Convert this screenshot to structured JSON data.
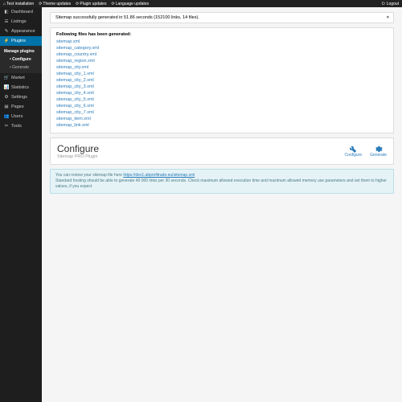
{
  "topbar": {
    "left": [
      {
        "icon": "home",
        "label": "Test installation"
      },
      {
        "icon": "refresh",
        "label": "Theme updates"
      },
      {
        "icon": "refresh",
        "label": "Plugin updates"
      },
      {
        "icon": "refresh",
        "label": "Language updates"
      }
    ],
    "logout": "Logout"
  },
  "sidebar": {
    "items": [
      {
        "icon": "dash",
        "label": "Dashboard"
      },
      {
        "icon": "list",
        "label": "Listings"
      },
      {
        "icon": "brush",
        "label": "Appearance"
      },
      {
        "icon": "plug",
        "label": "Plugins",
        "active": true
      }
    ],
    "sub": {
      "head": "Manage plugins",
      "items": [
        {
          "label": "Configure",
          "active": true
        },
        {
          "label": "Generate"
        }
      ]
    },
    "items2": [
      {
        "icon": "cart",
        "label": "Market"
      },
      {
        "icon": "stats",
        "label": "Statistics"
      },
      {
        "icon": "gear",
        "label": "Settings"
      },
      {
        "icon": "page",
        "label": "Pages"
      },
      {
        "icon": "users",
        "label": "Users"
      },
      {
        "icon": "tools",
        "label": "Tools"
      }
    ]
  },
  "alert": {
    "text": "Sitemap successfully generated in 51.86 seconds (152100 links, 14 files)."
  },
  "files": {
    "head": "Following files has been generated:",
    "list": [
      "sitemap.xml",
      "sitemap_category.xml",
      "sitemap_country.xml",
      "sitemap_region.xml",
      "sitemap_city.xml",
      "sitemap_city_1.xml",
      "sitemap_city_2.xml",
      "sitemap_city_3.xml",
      "sitemap_city_4.xml",
      "sitemap_city_5.xml",
      "sitemap_city_6.xml",
      "sitemap_city_7.xml",
      "sitemap_item.xml",
      "sitemap_link.xml"
    ]
  },
  "configure": {
    "title": "Configure",
    "subtitle": "Sitemap PRO Plugin",
    "actions": {
      "configure": "Configure",
      "generate": "Generate"
    }
  },
  "info": {
    "pre": "You can review your sitemap file here ",
    "link": "https://dev1.abprofitrade.eu/sitemap.xml",
    "line2": "Standard hosting should be able to generate 40 000 links per 30 seconds. Check maximum allowed execution time and maximum allowed memory use parameters and set them to higher values, if you expect"
  }
}
